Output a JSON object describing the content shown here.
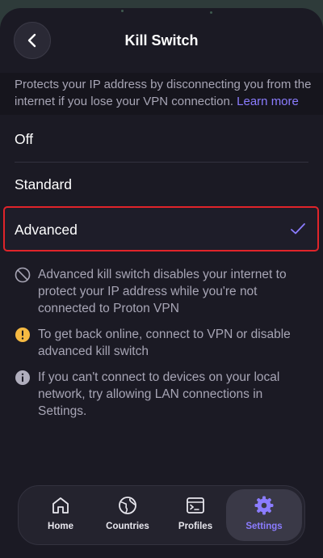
{
  "header": {
    "title": "Kill Switch",
    "back_icon": "chevron-left-icon"
  },
  "description": {
    "text": "Protects your IP address by disconnecting you from the internet if you lose your VPN connection.",
    "link": "Learn more"
  },
  "options": [
    {
      "label": "Off",
      "selected": false
    },
    {
      "label": "Standard",
      "selected": false
    },
    {
      "label": "Advanced",
      "selected": true
    }
  ],
  "info": [
    {
      "icon": "block-icon",
      "text": "Advanced kill switch disables your internet to protect your IP address while you're not connected to Proton VPN"
    },
    {
      "icon": "warning-icon",
      "text": "To get back online, connect to VPN or disable advanced kill switch"
    },
    {
      "icon": "info-icon",
      "text": "If you can't connect to devices on your local network, try allowing LAN connections in Settings."
    }
  ],
  "tabs": [
    {
      "label": "Home",
      "icon": "home-icon",
      "active": false
    },
    {
      "label": "Countries",
      "icon": "globe-icon",
      "active": false
    },
    {
      "label": "Profiles",
      "icon": "terminal-icon",
      "active": false
    },
    {
      "label": "Settings",
      "icon": "gear-icon",
      "active": true
    }
  ],
  "colors": {
    "accent": "#8b7cff",
    "background": "#1b1a24",
    "highlight_border": "#e0242a",
    "warning": "#f5b942"
  }
}
